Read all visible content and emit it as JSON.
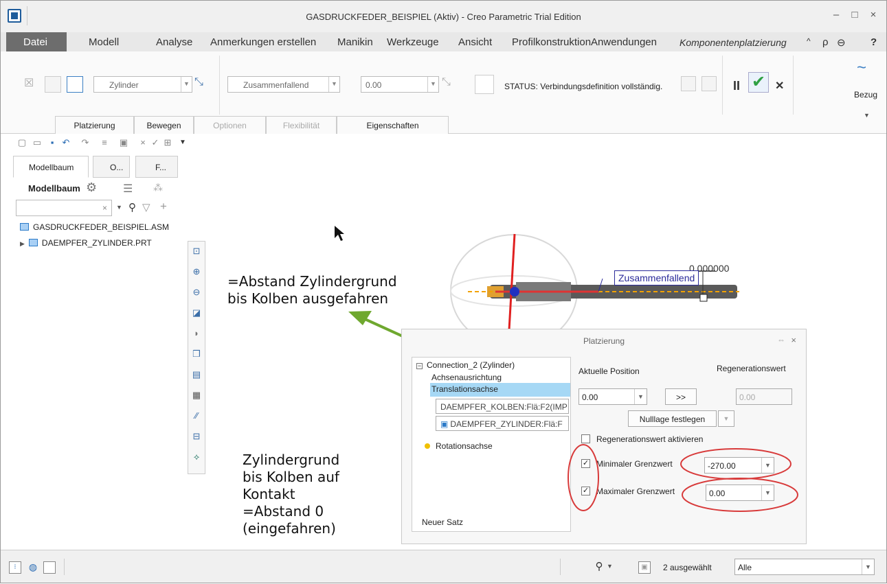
{
  "window": {
    "title": "GASDRUCKFEDER_BEISPIEL (Aktiv) - Creo Parametric Trial Edition"
  },
  "menubar": {
    "items": [
      "Datei",
      "Modell",
      "Analyse",
      "Anmerkungen erstellen",
      "Manikin",
      "Werkzeuge",
      "Ansicht",
      "ProfilkonstruktionAnwendungen",
      "Komponentenplatzierung"
    ]
  },
  "ribbon": {
    "type_select": "Zylinder",
    "constraint_select": "Zusammenfallend",
    "offset_value": "0.00",
    "status": "STATUS: Verbindungsdefinition vollständig.",
    "bezug_label": "Bezug",
    "tabs": [
      "Platzierung",
      "Bewegen",
      "Optionen",
      "Flexibilität",
      "Eigenschaften"
    ]
  },
  "left_panel": {
    "tabs": [
      "Modellbaum",
      "O...",
      "F..."
    ],
    "header": "Modellbaum",
    "tree": [
      "GASDRUCKFEDER_BEISPIEL.ASM",
      "DAEMPFER_ZYLINDER.PRT"
    ]
  },
  "canvas": {
    "dimension_text": "0.000000",
    "constraint_label": "Zusammenfallend",
    "annotation_top": "=Abstand Zylindergrund\nbis Kolben ausgefahren",
    "annotation_bottom": "Zylindergrund\nbis Kolben auf\nKontakt\n=Abstand 0\n(eingefahren)"
  },
  "dialog": {
    "title": "Platzierung",
    "tree": {
      "connection": "Connection_2 (Zylinder)",
      "axis_alignment": "Achsenausrichtung",
      "translation": "Translationsachse",
      "ref1": "DAEMPFER_KOLBEN:Flä:F2(IMP",
      "ref2": "DAEMPFER_ZYLINDER:Flä:F",
      "rotation": "Rotationsachse",
      "new_set": "Neuer Satz"
    },
    "current_position_label": "Aktuelle Position",
    "regen_value_label": "Regenerationswert",
    "current_position_value": "0.00",
    "copy_button": ">>",
    "regen_value": "0.00",
    "zero_button": "Nulllage festlegen",
    "regen_enable_label": "Regenerationswert aktivieren",
    "min_label": "Minimaler Grenzwert",
    "min_value": "-270.00",
    "max_label": "Maximaler Grenzwert",
    "max_value": "0.00"
  },
  "statusbar": {
    "selected": "2 ausgewählt",
    "filter": "Alle"
  },
  "colors": {
    "accent": "#2a7ac8",
    "annotation_red": "#d83a3a",
    "arrow_green": "#6fa82f",
    "confirm_green": "#2ea043"
  }
}
